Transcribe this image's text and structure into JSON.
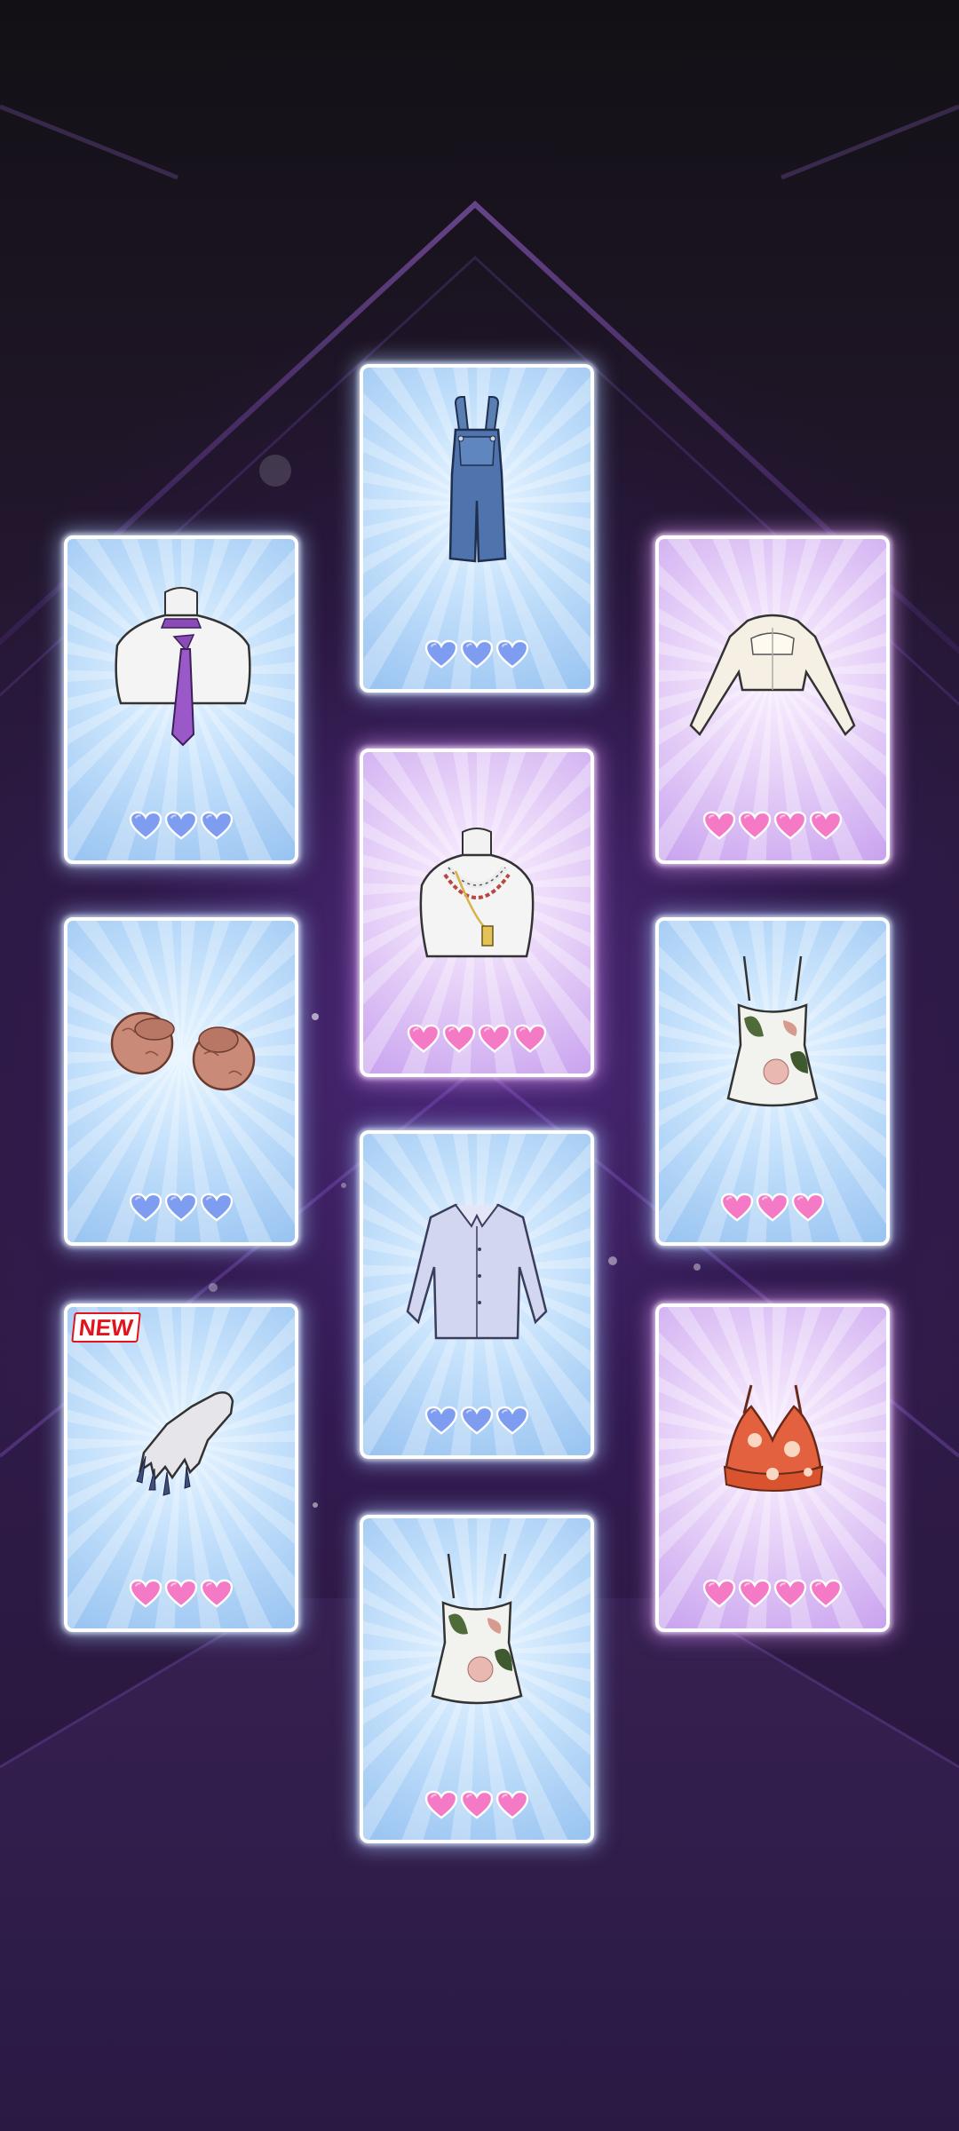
{
  "colors": {
    "heart_blue": "#7e9cf0",
    "heart_pink": "#f47ac6",
    "new_badge": "#e0141c"
  },
  "cards": [
    {
      "id": "overalls",
      "item": "denim-overalls-icon",
      "rarity": "blue",
      "hearts": 3
    },
    {
      "id": "tie",
      "item": "purple-tie-icon",
      "rarity": "blue",
      "hearts": 3
    },
    {
      "id": "cardigan",
      "item": "cream-cropped-cardigan-icon",
      "rarity": "pink",
      "hearts": 4
    },
    {
      "id": "necklace",
      "item": "layered-necklace-icon",
      "rarity": "pink",
      "hearts": 4
    },
    {
      "id": "slippers",
      "item": "fur-slippers-icon",
      "rarity": "blue",
      "hearts": 3
    },
    {
      "id": "floral-cami-right",
      "item": "floral-camisole-icon",
      "rarity": "pink",
      "hearts": 3
    },
    {
      "id": "shirt",
      "item": "lavender-shirt-icon",
      "rarity": "blue",
      "hearts": 3
    },
    {
      "id": "manicure",
      "item": "manicure-hand-icon",
      "rarity": "pink",
      "hearts": 3,
      "badge": "NEW"
    },
    {
      "id": "bralette",
      "item": "orange-floral-bralette-icon",
      "rarity": "pink",
      "hearts": 4
    },
    {
      "id": "floral-cami-center",
      "item": "floral-camisole-icon",
      "rarity": "pink",
      "hearts": 3
    }
  ]
}
